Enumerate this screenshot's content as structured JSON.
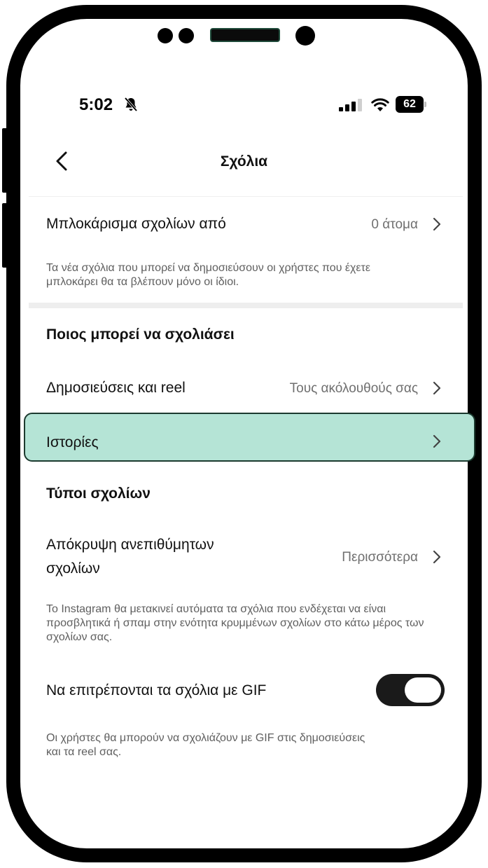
{
  "status_bar": {
    "time": "5:02",
    "battery": "62"
  },
  "header": {
    "title": "Σχόλια"
  },
  "block_comments": {
    "label": "Μπλοκάρισμα σχολίων από",
    "value": "0 άτομα",
    "description": "Τα νέα σχόλια που μπορεί να δημοσιεύσουν οι χρήστες που έχετε μπλοκάρει θα τα βλέπουν μόνο οι ίδιοι."
  },
  "who_can_comment": {
    "title": "Ποιος μπορεί να σχολιάσει",
    "posts": {
      "label": "Δημοσιεύσεις και reel",
      "value": "Τους ακόλουθούς σας"
    },
    "stories": {
      "label": "Ιστορίες"
    }
  },
  "comment_types": {
    "title": "Τύποι σχολίων",
    "hide_unwanted": {
      "label_line1": "Απόκρυψη ανεπιθύμητων",
      "label_line2": "σχολίων",
      "value": "Περισσότερα",
      "description": "Το Instagram θα μετακινεί αυτόματα τα σχόλια που ενδέχεται να είναι προσβλητικά ή σπαμ στην ενότητα κρυμμένων σχολίων στο κάτω μέρος των σχολίων σας."
    },
    "gif": {
      "label": "Να επιτρέπονται τα σχόλια με GIF",
      "enabled": true,
      "description": "Οι χρήστες θα μπορούν να σχολιάζουν με GIF στις δημοσιεύσεις και τα reel σας."
    }
  }
}
